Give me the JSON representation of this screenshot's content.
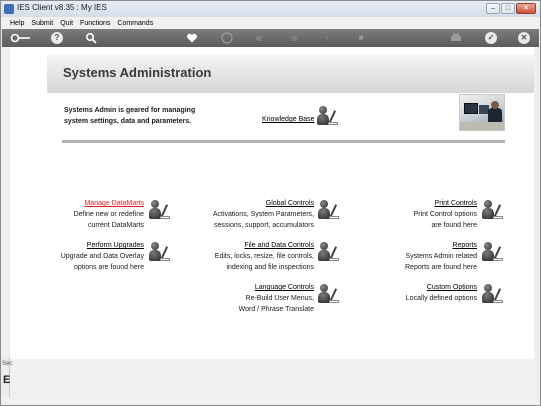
{
  "window": {
    "title": "IES Client v8.35 : My IES",
    "controls": [
      "–",
      "□",
      "✕"
    ]
  },
  "menu": [
    "Help",
    "Submit",
    "Quit",
    "Functions",
    "Commands"
  ],
  "toolbar": {
    "icons": [
      "key-icon",
      "help-icon",
      "search-icon",
      "heart-icon",
      "info-icon",
      "rewind-icon",
      "forward-icon",
      "upload-icon",
      "stop-icon",
      "print-icon",
      "check-icon",
      "close-icon"
    ],
    "glyphs": {
      "help": "?",
      "info": "i",
      "rewind": "«",
      "forward": "»",
      "upload": "↑",
      "stop": "■",
      "check": "✓",
      "close": "✕"
    }
  },
  "page": {
    "title": "Systems Administration",
    "intro_line1": "Systems Admin is geared for managing",
    "intro_line2": "system settings, data and parameters.",
    "knowledge_base": "Knowledge Base"
  },
  "actions": {
    "manage_datamarts": {
      "label": "Manage DataMarts",
      "desc1": "Define new or redefine",
      "desc2": "current DataMarts"
    },
    "perform_upgrades": {
      "label": "Perform Upgrades",
      "desc1": "Upgrade and Data Overlay",
      "desc2": "options are found here"
    },
    "global_controls": {
      "label": "Global Controls",
      "desc1": "Activations, System Parameters,",
      "desc2": "sessions, support, accumulators"
    },
    "file_data_controls": {
      "label": "File and Data Controls",
      "desc1": "Edits, locks, resize, file controls,",
      "desc2": "indexing and file inspections"
    },
    "language_controls": {
      "label": "Language Controls",
      "desc1": "Re-Build User Menus,",
      "desc2": "Word / Phrase Translate"
    },
    "print_controls": {
      "label": "Print Controls",
      "desc1": "Print Control options",
      "desc2": "are found here"
    },
    "reports": {
      "label": "Reports",
      "desc1": "Systems Admin related",
      "desc2": "Reports are found here"
    },
    "custom_options": {
      "label": "Custom Options",
      "desc1": "Locally defined options"
    }
  },
  "side": {
    "short": "Sec",
    "letter": "E"
  },
  "colors": {
    "toolbar": "#6b6b6b",
    "active_link": "#e02020",
    "divider": "#b3b3b3"
  }
}
